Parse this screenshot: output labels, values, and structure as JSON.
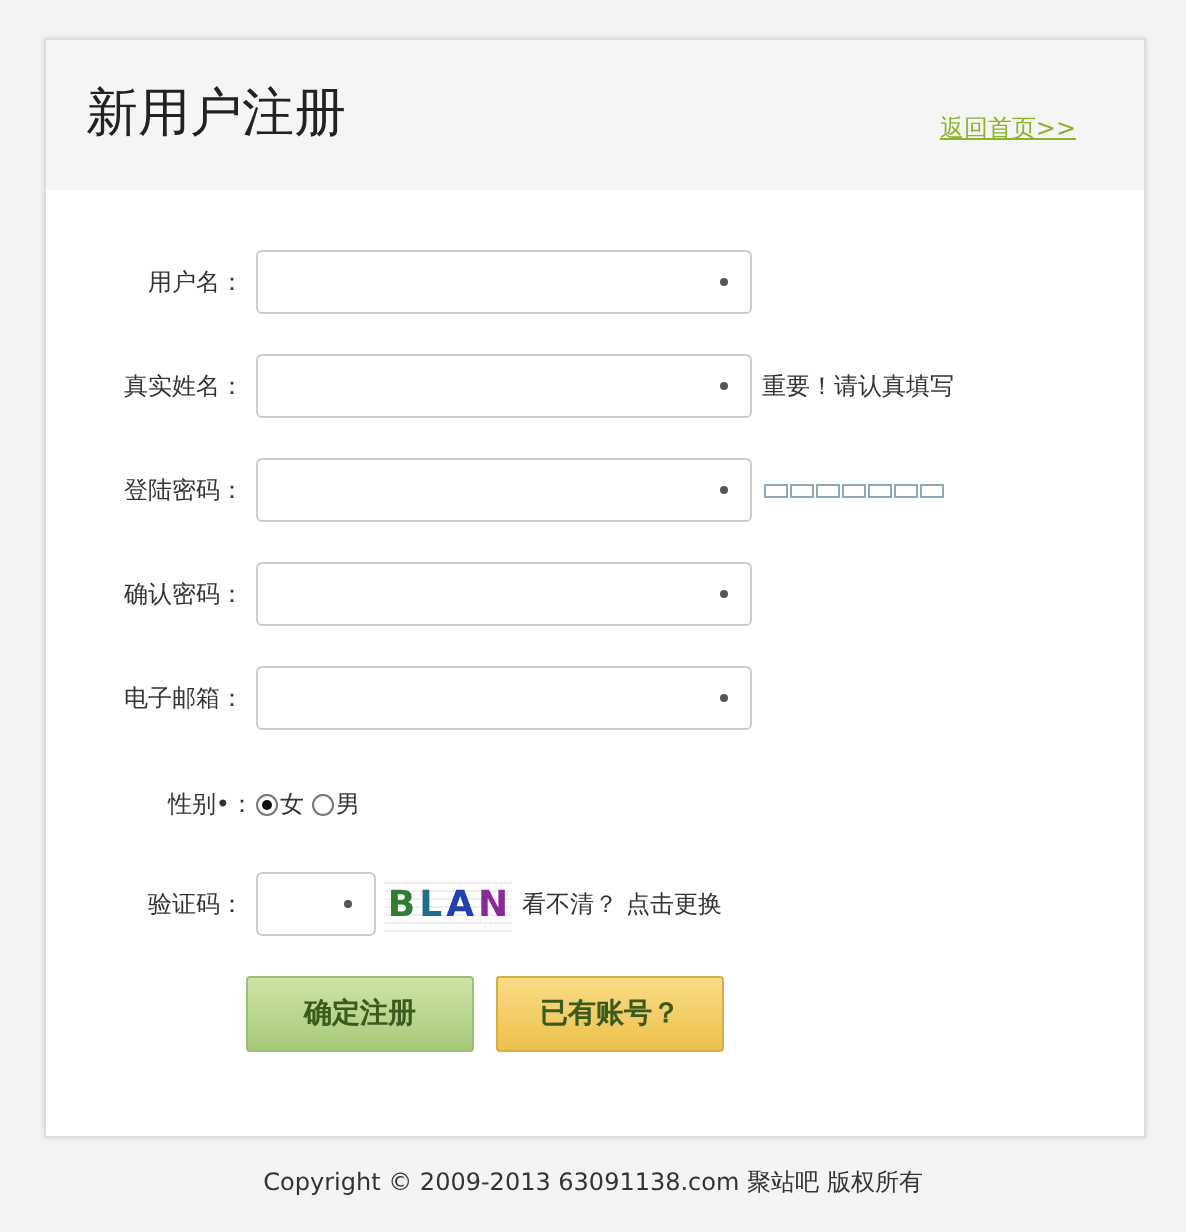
{
  "header": {
    "title": "新用户注册",
    "home_link": "返回首页>>"
  },
  "fields": [
    {
      "label": "用户名："
    },
    {
      "label": "真实姓名：",
      "note": "重要！请认真填写"
    },
    {
      "label": "登陆密码：",
      "strength_meter": true
    },
    {
      "label": "确认密码："
    },
    {
      "label": "电子邮箱："
    }
  ],
  "gender": {
    "label": "性别•：",
    "options": [
      {
        "label": "女",
        "selected": true
      },
      {
        "label": "男",
        "selected": false
      }
    ]
  },
  "captcha": {
    "label": "验证码：",
    "letters": [
      {
        "char": "B",
        "color": "#2e7d32"
      },
      {
        "char": "L",
        "color": "#1e6e8e"
      },
      {
        "char": "A",
        "color": "#2340b0"
      },
      {
        "char": "N",
        "color": "#8a2a9a"
      }
    ],
    "refresh": "看不清？ 点击更换"
  },
  "buttons": [
    {
      "kind": "primary",
      "label": "确定注册"
    },
    {
      "kind": "secondary",
      "label": "已有账号？"
    }
  ],
  "footer": "Copyright © 2009-2013 63091138.com 聚站吧 版权所有"
}
